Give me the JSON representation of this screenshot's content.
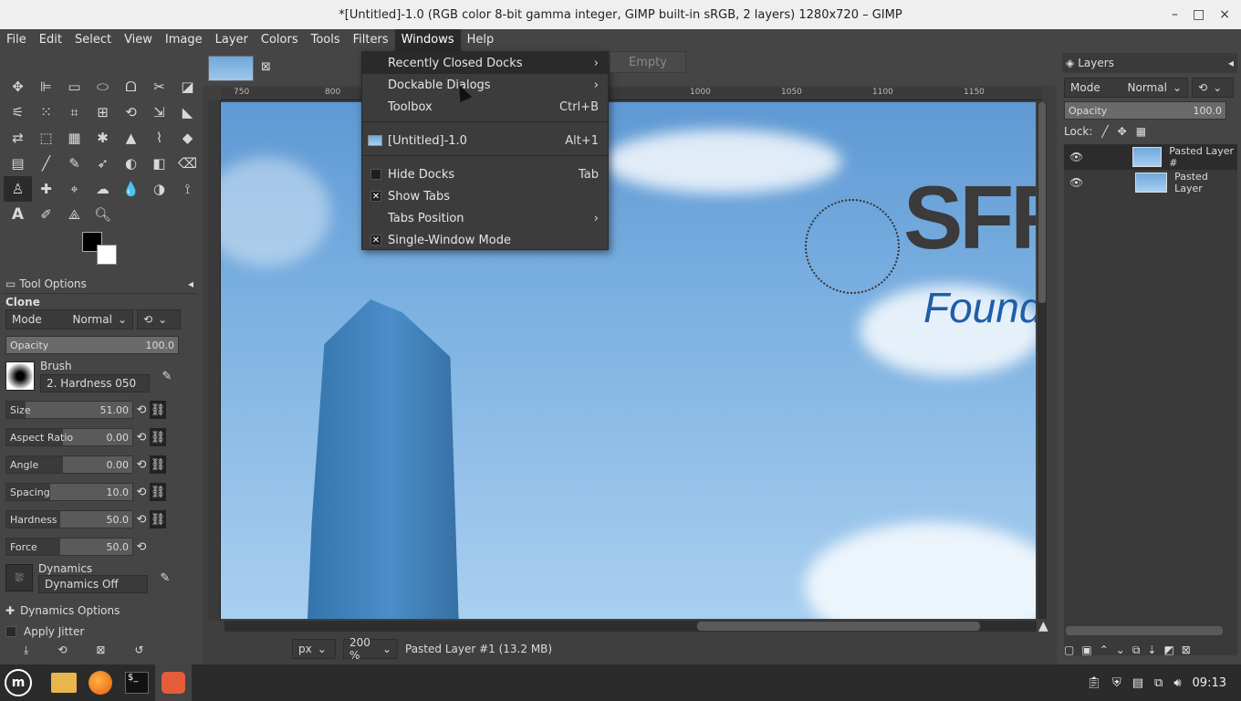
{
  "window": {
    "title": "*[Untitled]-1.0 (RGB color 8-bit gamma integer, GIMP built-in sRGB, 2 layers) 1280x720 – GIMP",
    "minimize": "–",
    "maximize": "□",
    "close": "×"
  },
  "menubar": [
    "File",
    "Edit",
    "Select",
    "View",
    "Image",
    "Layer",
    "Colors",
    "Tools",
    "Filters",
    "Windows",
    "Help"
  ],
  "windows_menu": {
    "items": [
      {
        "label": "Recently Closed Docks",
        "accel": "›"
      },
      {
        "label": "Dockable Dialogs",
        "accel": "›"
      },
      {
        "label": "Toolbox",
        "accel": "Ctrl+B"
      },
      {
        "label": "[Untitled]-1.0",
        "accel": "Alt+1"
      },
      {
        "label": "Hide Docks",
        "accel": "Tab"
      },
      {
        "label": "Show Tabs",
        "accel": ""
      },
      {
        "label": "Tabs Position",
        "accel": "›"
      },
      {
        "label": "Single-Window Mode",
        "accel": ""
      }
    ],
    "submenu_empty": "Empty",
    "checks": {
      "hide_docks": false,
      "show_tabs": true,
      "single_window": true
    }
  },
  "tool_options": {
    "tab_label": "Tool Options",
    "tool_name": "Clone",
    "mode_label": "Mode",
    "mode_value": "Normal",
    "opacity_label": "Opacity",
    "opacity_value": "100.0",
    "brush_label": "Brush",
    "brush_value": "2. Hardness 050",
    "size_label": "Size",
    "size_value": "51.00",
    "aspect_label": "Aspect Ratio",
    "aspect_value": "0.00",
    "angle_label": "Angle",
    "angle_value": "0.00",
    "spacing_label": "Spacing",
    "spacing_value": "10.0",
    "hardness_label": "Hardness",
    "hardness_value": "50.0",
    "force_label": "Force",
    "force_value": "50.0",
    "dynamics_label": "Dynamics",
    "dynamics_value": "Dynamics Off",
    "dynamics_options": "Dynamics Options",
    "apply_jitter": "Apply Jitter"
  },
  "ruler": {
    "ticks": [
      "750",
      "800",
      "1000",
      "1050",
      "1100",
      "1150"
    ]
  },
  "image": {
    "logo_text": "SFF",
    "logo_sub": "Founda"
  },
  "statusbar": {
    "unit": "px",
    "zoom": "200 %",
    "info": "Pasted Layer #1 (13.2 MB)"
  },
  "layers_panel": {
    "tab_label": "Layers",
    "mode_label": "Mode",
    "mode_value": "Normal",
    "opacity_label": "Opacity",
    "opacity_value": "100.0",
    "lock_label": "Lock:",
    "layers": [
      "Pasted Layer #",
      "Pasted Layer"
    ]
  },
  "taskbar": {
    "clock": "09:13"
  }
}
